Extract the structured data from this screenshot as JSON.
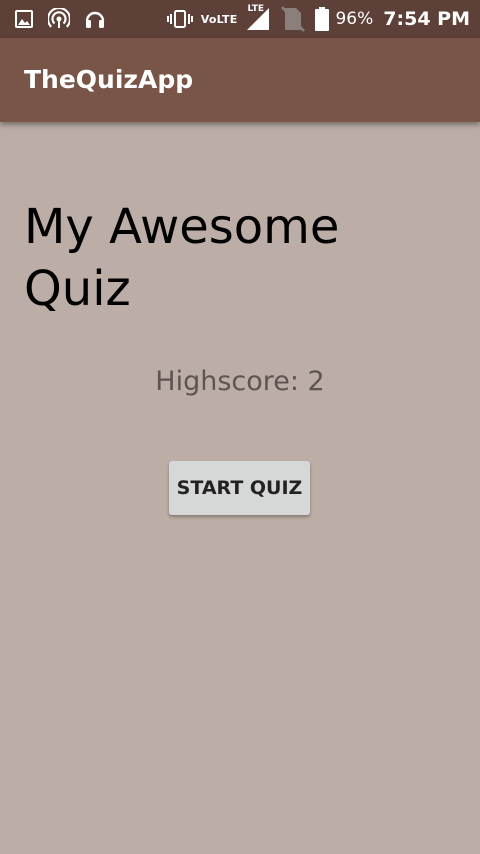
{
  "status_bar": {
    "left_icons": [
      "image-icon",
      "hotspot-icon",
      "headset-icon"
    ],
    "network_label": "VoLTE",
    "lte_label": "LTE",
    "battery_percent": "96%",
    "time": "7:54 PM"
  },
  "app_bar": {
    "title": "TheQuizApp",
    "color": "#795548",
    "status_color": "#5d4037"
  },
  "main": {
    "heading": "My Awesome Quiz",
    "highscore": "Highscore: 2",
    "start_button_label": "START QUIZ",
    "background": "#bcada6"
  }
}
